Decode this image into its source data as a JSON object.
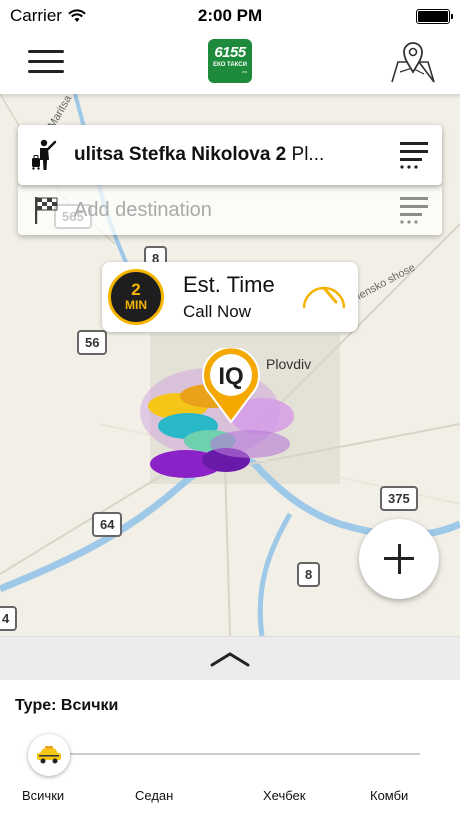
{
  "status": {
    "carrier": "Carrier",
    "time": "2:00 PM"
  },
  "header": {
    "logo_number": "6155",
    "logo_text": "ЕКО ТАКСИ",
    "logo_small": ".eu"
  },
  "map": {
    "road_badges": [
      "565",
      "8",
      "56",
      "375",
      "64",
      "8",
      "4"
    ],
    "city": "Plovdiv",
    "road_label": "lensko shose",
    "river_label": "Maritsa"
  },
  "pickup": {
    "address_bold": "ulitsa Stefka Nikolova 2",
    "address_rest": " Pl..."
  },
  "destination": {
    "placeholder": "Add destination"
  },
  "estimate": {
    "minutes": "2",
    "unit": "MIN",
    "title": "Est. Time",
    "action": "Call Now"
  },
  "type_selector": {
    "title": "Type: Всички",
    "options": [
      "Всички",
      "Седан",
      "Хечбек",
      "Комби"
    ],
    "selected_index": 0
  },
  "colors": {
    "accent": "#f5b400",
    "brand_green": "#1e8a3c",
    "river": "#9ec8e8"
  }
}
